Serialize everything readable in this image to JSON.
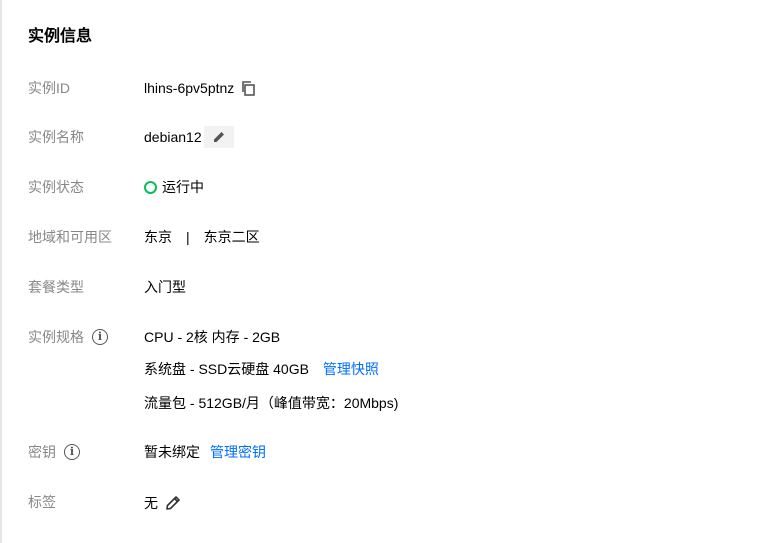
{
  "title": "实例信息",
  "rows": {
    "instance_id": {
      "label": "实例ID",
      "value": "lhins-6pv5ptnz"
    },
    "instance_name": {
      "label": "实例名称",
      "value": "debian12"
    },
    "instance_status": {
      "label": "实例状态",
      "value": "运行中",
      "status_color": "#0abf5b"
    },
    "region": {
      "label": "地域和可用区",
      "region": "东京",
      "separator": "|",
      "zone": "东京二区"
    },
    "package_type": {
      "label": "套餐类型",
      "value": "入门型"
    },
    "spec": {
      "label": "实例规格",
      "cpu_mem": "CPU - 2核 内存 - 2GB",
      "disk": "系统盘 - SSD云硬盘 40GB",
      "disk_link": "管理快照",
      "traffic": "流量包 - 512GB/月（峰值带宽：20Mbps)"
    },
    "key": {
      "label": "密钥",
      "value": "暂未绑定",
      "link": "管理密钥"
    },
    "tags": {
      "label": "标签",
      "value": "无"
    }
  },
  "icons": {
    "copy": "copy-icon",
    "edit": "pencil-icon",
    "info": "info-icon"
  },
  "info_glyph": "i",
  "colors": {
    "link": "#006eff",
    "label": "#888888",
    "status": "#0abf5b"
  }
}
